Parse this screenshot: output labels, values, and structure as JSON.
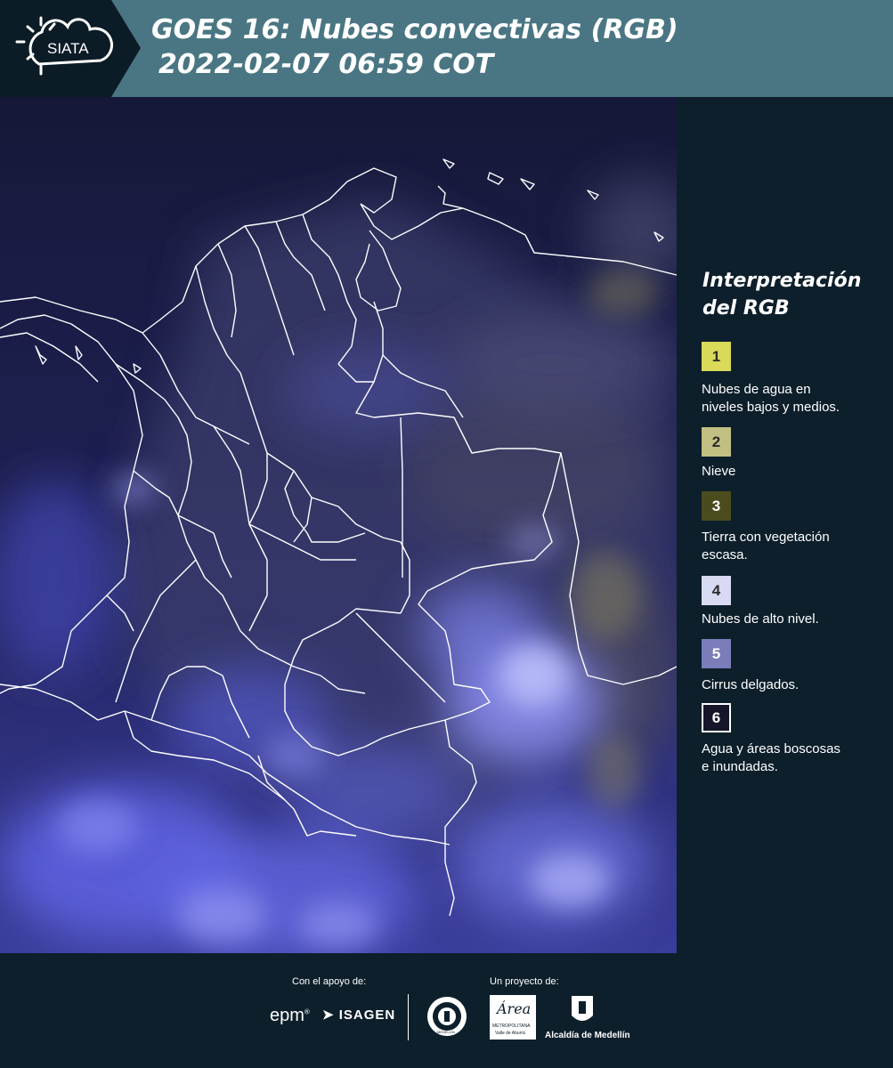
{
  "header": {
    "logo_text": "SIATA",
    "title_line1": "GOES 16: Nubes convectivas (RGB)",
    "title_line2": "2022-02-07 06:59 COT",
    "background_color": "#4a7683"
  },
  "legend": {
    "title_line1": "Interpretación",
    "title_line2": "del RGB",
    "items": [
      {
        "number": "1",
        "color": "#d9d95a",
        "label_line1": "Nubes de agua en",
        "label_line2": "niveles bajos y medios."
      },
      {
        "number": "2",
        "color": "#c2bf82",
        "label_line1": "Nieve",
        "label_line2": ""
      },
      {
        "number": "3",
        "color": "#4b4c1e",
        "label_line1": "Tierra con vegetación",
        "label_line2": "escasa."
      },
      {
        "number": "4",
        "color": "#d8d9f2",
        "label_line1": "Nubes de alto nivel.",
        "label_line2": ""
      },
      {
        "number": "5",
        "color": "#7b7dba",
        "label_line1": "Cirrus delgados.",
        "label_line2": ""
      },
      {
        "number": "6",
        "color": "#16162a",
        "label_line1": "Agua y áreas boscosas",
        "label_line2": "e inundadas."
      }
    ]
  },
  "footer": {
    "support_caption": "Con el apoyo de:",
    "project_caption": "Un proyecto de:",
    "epm_text": "epm",
    "isagen_text": "ISAGEN",
    "area_text": "Área",
    "area_sub1": "METROPOLITANA",
    "area_sub2": "Valle de Aburrá",
    "medellin_seal_text": "MEDELLÍN",
    "alcaldia_text": "Alcaldía de Medellín"
  },
  "map": {
    "ocean_color": "#1a1b4a",
    "cloud_color": "#6f73f0",
    "border_color": "#ffffff"
  }
}
